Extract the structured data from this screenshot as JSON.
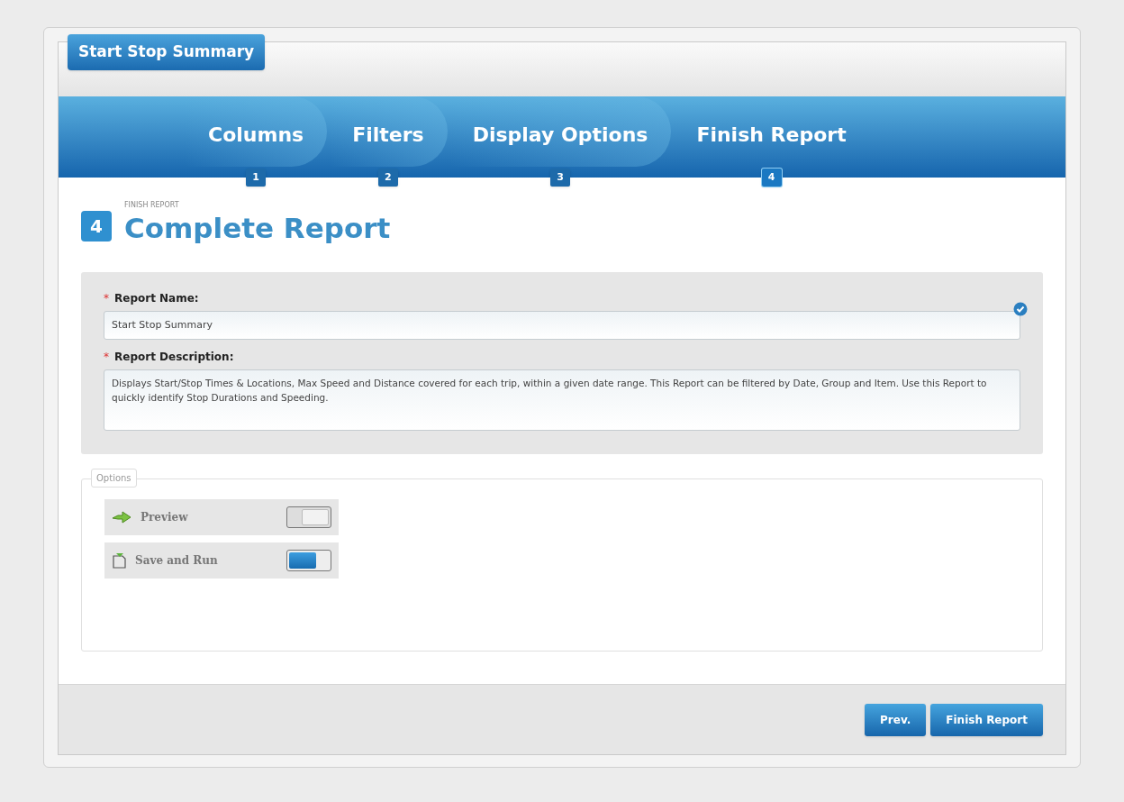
{
  "window": {
    "title": "Start Stop Summary"
  },
  "steps": [
    {
      "label": "Columns",
      "number": "1",
      "selected": false
    },
    {
      "label": "Filters",
      "number": "2",
      "selected": false
    },
    {
      "label": "Display Options",
      "number": "3",
      "selected": false
    },
    {
      "label": "Finish Report",
      "number": "4",
      "selected": true
    }
  ],
  "section": {
    "number": "4",
    "overline": "FINISH REPORT",
    "title": "Complete Report"
  },
  "form": {
    "fields": [
      {
        "kind": "input",
        "label": "Report Name:",
        "required_mark": "*",
        "value": "Start Stop Summary",
        "valid": true
      },
      {
        "kind": "textarea",
        "label": "Report Description:",
        "required_mark": "*",
        "value": "Displays Start/Stop Times & Locations, Max Speed and Distance covered for each trip, within a given date range.  This Report can be filtered by Date, Group and Item.  Use this Report to quickly identify Stop Durations and Speeding.",
        "valid": false
      }
    ]
  },
  "options": {
    "legend": "Options",
    "items": [
      {
        "kind": "preview",
        "label": "Preview",
        "on": false
      },
      {
        "kind": "save",
        "label": "Save and Run",
        "on": true
      }
    ]
  },
  "footer": {
    "buttons": [
      "Prev.",
      "Finish Report"
    ]
  }
}
